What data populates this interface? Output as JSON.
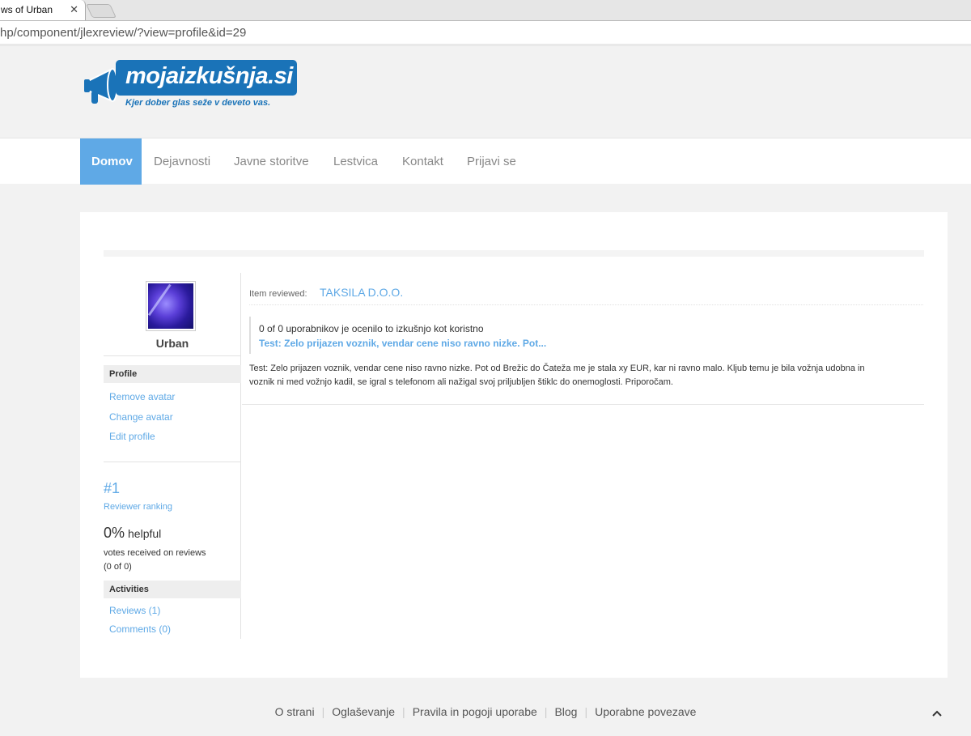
{
  "browser": {
    "tab_title": "ws of Urban",
    "tab_close": "✕",
    "url": "hp/component/jlexreview/?view=profile&id=29"
  },
  "header": {
    "logo_text": "mojaizkušnja.si",
    "logo_tagline": "Kjer dober glas seže v deveto vas."
  },
  "nav": {
    "items": [
      "Domov",
      "Dejavnosti",
      "Javne storitve",
      "Lestvica",
      "Kontakt",
      "Prijavi se"
    ],
    "active_index": 0,
    "active_color": "#5fa9e6"
  },
  "sidebar": {
    "username": "Urban",
    "profile_head": "Profile",
    "profile_links": [
      "Remove avatar",
      "Change avatar",
      "Edit profile"
    ],
    "rank": "#1",
    "rank_label": "Reviewer ranking",
    "helpful_pct": "0%",
    "helpful_word": "helpful",
    "votes_label": "votes received on reviews",
    "votes_count": "(0 of 0)",
    "activities_head": "Activities",
    "activity_links": [
      "Reviews (1)",
      "Comments (0)"
    ]
  },
  "review": {
    "item_label": "Item reviewed:",
    "item_name": "TAKSILA D.O.O.",
    "helpful_text": "0 of 0 uporabnikov je ocenilo to izkušnjo kot koristno",
    "title": "Test: Zelo prijazen voznik, vendar cene niso ravno nizke. Pot...",
    "body_line1": "Test: Zelo prijazen voznik, vendar cene niso ravno nizke. Pot od Brežic do Čateža me je stala xy EUR, kar ni ravno malo. Kljub temu je bila vožnja udobna in",
    "body_line2": "voznik ni med vožnjo kadil, se igral s telefonom ali nažigal svoj priljubljen štiklc do onemoglosti. Priporočam."
  },
  "footer": {
    "links": [
      "O strani",
      "Oglaševanje",
      "Pravila in pogoji uporabe",
      "Blog",
      "Uporabne povezave"
    ],
    "to_top_icon": "chevron-up-icon"
  }
}
